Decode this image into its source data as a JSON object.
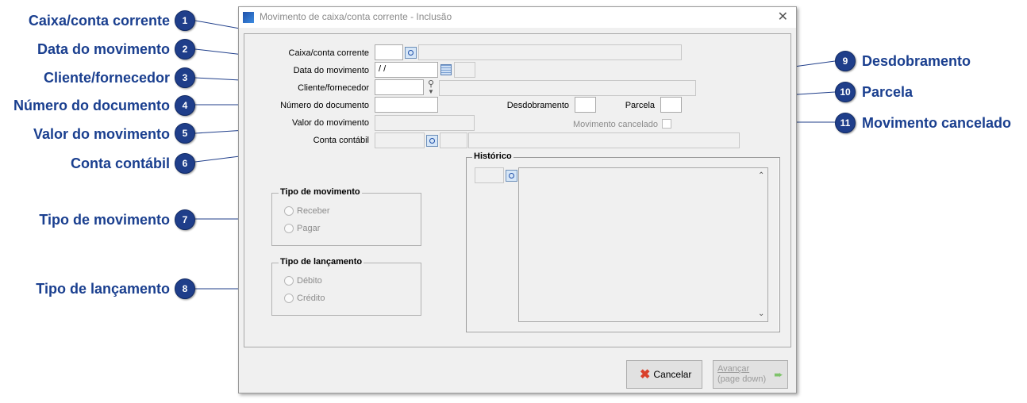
{
  "window": {
    "title": "Movimento de caixa/conta corrente - Inclusão",
    "close_glyph": "✕"
  },
  "form": {
    "caixa_label": "Caixa/conta corrente",
    "data_label": "Data do movimento",
    "data_value": " / /",
    "cliente_label": "Cliente/fornecedor",
    "numero_label": "Número do documento",
    "desdobramento_label": "Desdobramento",
    "parcela_label": "Parcela",
    "valor_label": "Valor do movimento",
    "cancelado_label": "Movimento cancelado",
    "conta_label": "Conta contábil"
  },
  "historico": {
    "title": "Histórico"
  },
  "tipo_movimento": {
    "title": "Tipo de movimento",
    "options": [
      "Receber",
      "Pagar"
    ]
  },
  "tipo_lancamento": {
    "title": "Tipo de lançamento",
    "options": [
      "Débito",
      "Crédito"
    ]
  },
  "buttons": {
    "cancel": "Cancelar",
    "next_line1": "Avançar",
    "next_line2": "(page down)"
  },
  "callouts": [
    {
      "number": "1",
      "label": "Caixa/conta corrente"
    },
    {
      "number": "2",
      "label": "Data do movimento"
    },
    {
      "number": "3",
      "label": "Cliente/fornecedor"
    },
    {
      "number": "4",
      "label": "Número do documento"
    },
    {
      "number": "5",
      "label": "Valor do movimento"
    },
    {
      "number": "6",
      "label": "Conta contábil"
    },
    {
      "number": "7",
      "label": "Tipo de movimento"
    },
    {
      "number": "8",
      "label": "Tipo de lançamento"
    },
    {
      "number": "9",
      "label": "Desdobramento"
    },
    {
      "number": "10",
      "label": "Parcela"
    },
    {
      "number": "11",
      "label": "Movimento cancelado"
    }
  ],
  "colors": {
    "callout_blue": "#1a3f8f",
    "badge_blue": "#1f3e8a"
  }
}
